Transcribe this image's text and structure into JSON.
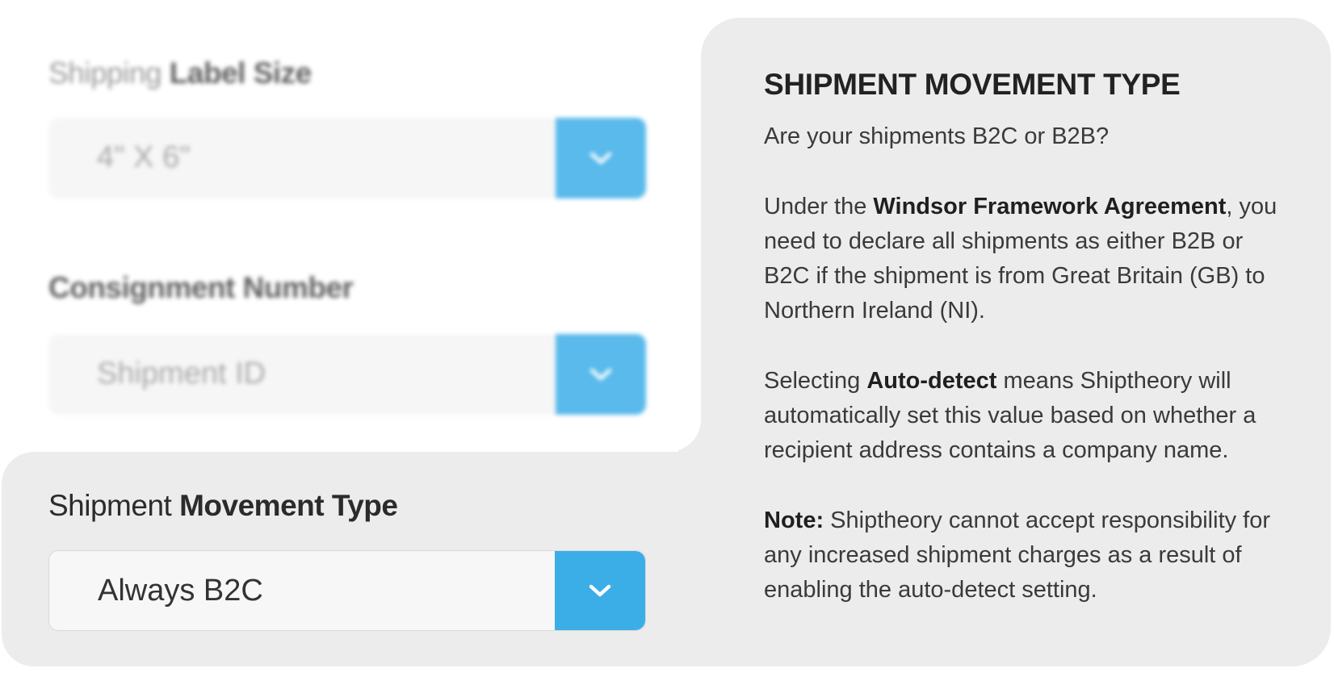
{
  "fields": {
    "label_size": {
      "label_prefix": "Shipping",
      "label_bold": "Label Size",
      "value": "4\" X 6\""
    },
    "consignment": {
      "label_prefix": "",
      "label_bold": "Consignment Number",
      "value": "Shipment ID"
    },
    "movement_type": {
      "label_prefix": "Shipment",
      "label_bold": "Movement Type",
      "value": "Always B2C"
    }
  },
  "help": {
    "title": "SHIPMENT MOVEMENT TYPE",
    "p1": "Are your shipments B2C or B2B?",
    "p2_a": "Under the ",
    "p2_bold": "Windsor Framework Agreement",
    "p2_b": ", you need to declare all shipments as either B2B or B2C if the shipment is from Great Britain (GB) to Northern Ireland (NI).",
    "p3_a": "Selecting ",
    "p3_bold": "Auto-detect",
    "p3_b": " means Shiptheory will automatically set this value based on whether a recipient address contains a company name.",
    "p4_bold": "Note:",
    "p4_b": " Shiptheory cannot accept responsibility for any increased shipment charges as a result of enabling the auto-detect setting."
  },
  "icons": {
    "dropdown": "chevron-down-icon"
  },
  "colors": {
    "accent": "#3baee8",
    "panel_bg": "#ececec"
  }
}
